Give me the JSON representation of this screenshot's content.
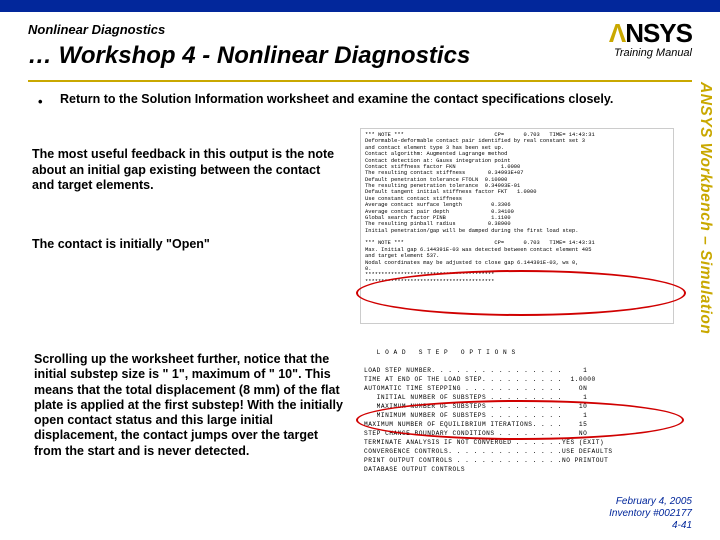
{
  "header": {
    "small": "Nonlinear Diagnostics",
    "main": "… Workshop 4 - Nonlinear Diagnostics",
    "logo_text": "NSYS",
    "training_label": "Training Manual"
  },
  "sidebar": "ANSYS Workbench – Simulation",
  "bullet": "Return to the Solution Information worksheet and examine the contact specifications closely.",
  "para1": "The most useful feedback in this output is the note about an initial gap existing between the contact and target elements.",
  "para2": "The contact is initially \"Open\"",
  "para3": "Scrolling up the worksheet further, notice that the initial substep size is \" 1\", maximum of \" 10\".  This means that the total displacement (8 mm) of the flat plate is applied at the first substep!  With the initially open contact status and this large initial displacement, the contact jumps over the target from the start and is never detected.",
  "output1": "*** NOTE ***                            CP=      0.703   TIME= 14:43:31\nDeformable-deformable contact pair identified by real constant set 3\nand contact element type 3 has been set up.\nContact algorithm: Augmented Lagrange method\nContact detection at: Gauss integration point\nContact stiffness factor FKN              1.0000\nThe resulting contact stiffness       0.34993E+07\nDefault penetration tolerance FTOLN  0.10000\nThe resulting penetration tolerance  0.34993E-01\nDefault tangent initial stiffness factor FKT   1.0000\nUse constant contact stiffness\nAverage contact surface length         0.3306\nAverage contact pair depth             0.34100\nGlobal search factor PINB              1.1100\nThe resulting pinball radius          0.38900\nInitial penetration/gap will be damped during the first load step.\n\n*** NOTE ***                            CP=      0.703   TIME= 14:43:31\nMax. Initial gap 6.144391E-03 was detected between contact element 405\nand target element 537.\nNodal coordinates may be adjusted to close gap 6.144391E-03, ws 0,\n0.\n****************************************\n****************************************",
  "output2": "   L O A D   S T E P   O P T I O N S\n\nLOAD STEP NUMBER. . . . . . . . . . . . . . . .     1\nTIME AT END OF THE LOAD STEP. . . . . . . . . .  1.0000\nAUTOMATIC TIME STEPPING . . . . . . . . . . . .    ON\n   INITIAL NUMBER OF SUBSTEPS . . . . . . . . .     1\n   MAXIMUM NUMBER OF SUBSTEPS . . . . . . . . .    10\n   MINIMUM NUMBER OF SUBSTEPS . . . . . . . . .     1\nMAXIMUM NUMBER OF EQUILIBRIUM ITERATIONS. . . .    15\nSTEP CHANGE BOUNDARY CONDITIONS . . . . . . . .    NO\nTERMINATE ANALYSIS IF NOT CONVERGED . . . . . .YES (EXIT)\nCONVERGENCE CONTROLS. . . . . . . . . . . . . .USE DEFAULTS\nPRINT OUTPUT CONTROLS . . . . . . . . . . . . .NO PRINTOUT\nDATABASE OUTPUT CONTROLS",
  "footer": {
    "date": "February 4, 2005",
    "inventory": "Inventory #002177",
    "page": "4-41"
  }
}
